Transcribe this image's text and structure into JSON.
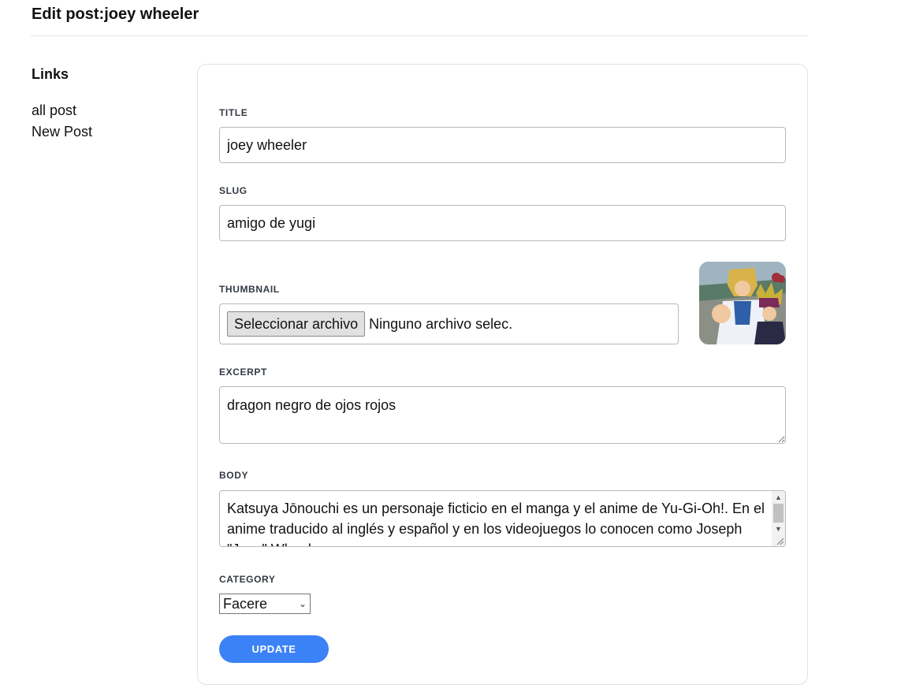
{
  "page": {
    "title": "Edit post:joey wheeler"
  },
  "sidebar": {
    "heading": "Links",
    "links": [
      {
        "label": "all post"
      },
      {
        "label": "New Post"
      }
    ]
  },
  "form": {
    "title": {
      "label": "TITLE",
      "value": "joey wheeler"
    },
    "slug": {
      "label": "SLUG",
      "value": "amigo de yugi"
    },
    "thumbnail": {
      "label": "THUMBNAIL",
      "button_label": "Seleccionar archivo",
      "status": "Ninguno archivo selec."
    },
    "excerpt": {
      "label": "EXCERPT",
      "value": "dragon negro de ojos rojos"
    },
    "body": {
      "label": "BODY",
      "value": "Katsuya Jōnouchi es un personaje ficticio en el manga y el anime de Yu-Gi-Oh!. En el anime traducido al inglés y español y en los videojuegos lo conocen como Joseph \"Joey\" Wheeler"
    },
    "category": {
      "label": "CATEGORY",
      "selected": "Facere"
    },
    "submit": {
      "label": "UPDATE"
    }
  },
  "colors": {
    "accent": "#3b82f6"
  },
  "icons": {
    "body_scroll_up": "scroll-up-arrow-icon",
    "body_scroll_down": "scroll-down-arrow-icon",
    "category_chevron": "chevron-down-icon"
  }
}
